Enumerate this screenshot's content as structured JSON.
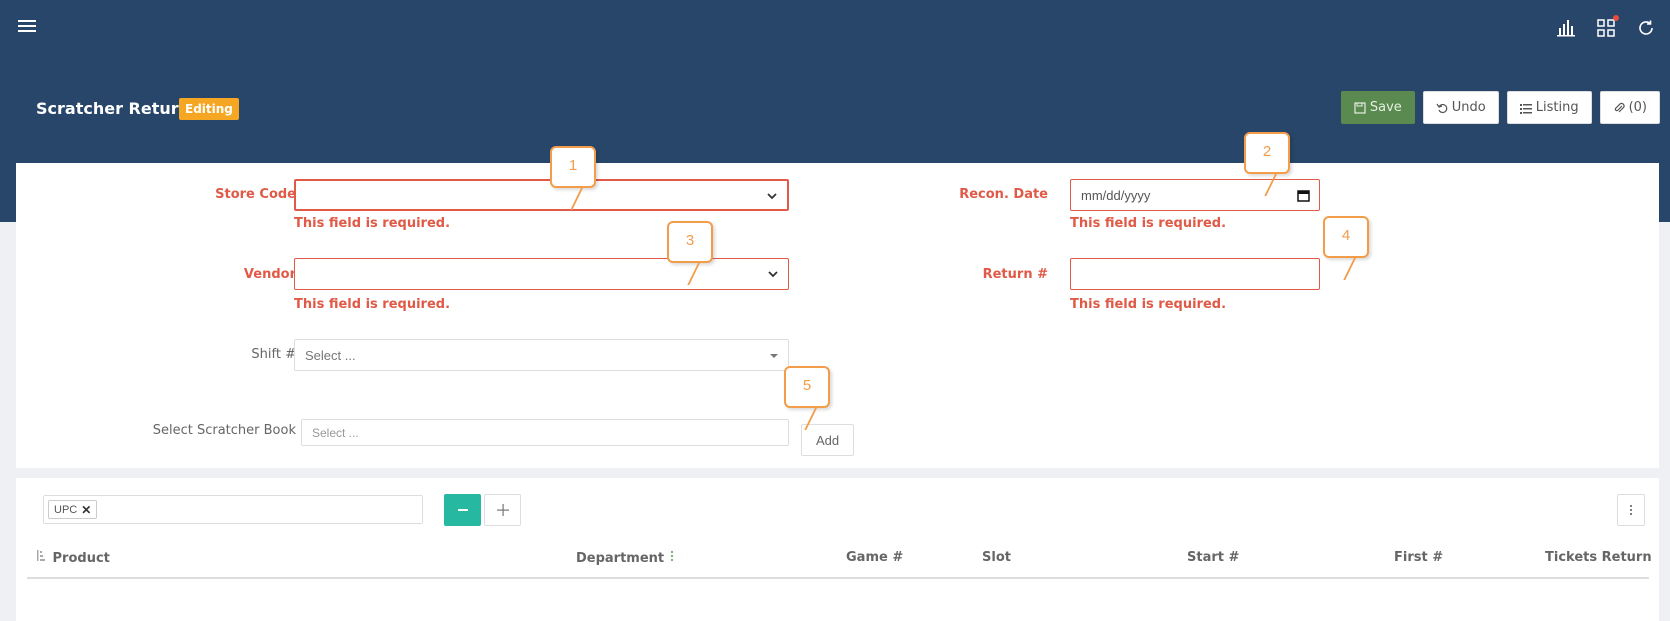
{
  "header": {
    "title": "Scratcher Return",
    "badge": "Editing"
  },
  "toolbar": {
    "save_label": "Save",
    "undo_label": "Undo",
    "listing_label": "Listing",
    "attachments_label": "(0)"
  },
  "form": {
    "store_code": {
      "label": "Store Code",
      "value": "",
      "error": "This field is required."
    },
    "vendor": {
      "label": "Vendor",
      "value": "",
      "error": "This field is required."
    },
    "shift": {
      "label": "Shift #",
      "placeholder": "Select ..."
    },
    "scratcher_book": {
      "label": "Select Scratcher Book",
      "placeholder": "Select ...",
      "add_label": "Add"
    },
    "recon_date": {
      "label": "Recon. Date",
      "placeholder": "mm/dd/yyyy",
      "error": "This field is required."
    },
    "return_no": {
      "label": "Return #",
      "value": "",
      "error": "This field is required."
    }
  },
  "callouts": [
    "1",
    "2",
    "3",
    "4",
    "5"
  ],
  "table": {
    "group_tags": [
      "UPC"
    ],
    "columns": [
      "Product",
      "Department",
      "Game #",
      "Slot",
      "Start #",
      "First #",
      "Tickets Return"
    ]
  },
  "colors": {
    "header_bg": "#27466a",
    "badge": "#f5a623",
    "save": "#5a8a4f",
    "error": "#e05a47",
    "teal": "#26b8a0",
    "callout": "#f39c4a"
  }
}
